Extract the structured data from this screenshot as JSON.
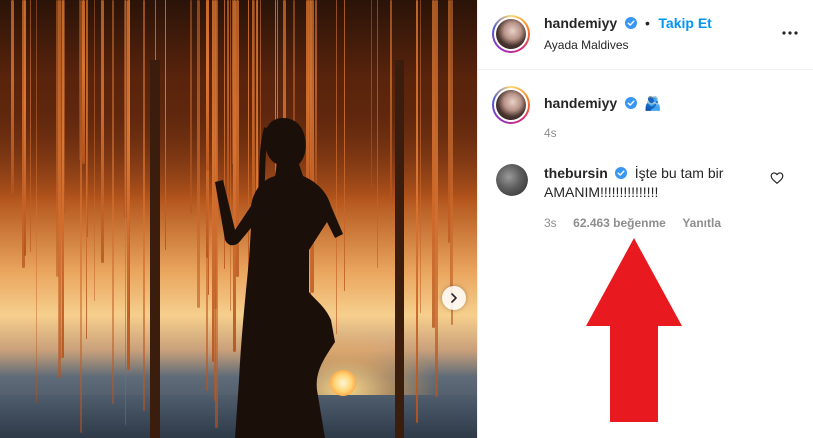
{
  "post": {
    "author": {
      "username": "handemiyy",
      "verified": true,
      "follow_label": "Takip Et",
      "location": "Ayada Maldives"
    },
    "caption": {
      "username": "handemiyy",
      "verified": true,
      "emoji": "🫂",
      "time": "4s"
    },
    "comments": [
      {
        "username": "thebursin",
        "verified": true,
        "text_line1": "İşte bu tam bir",
        "text_line2": "AMANIM!!!!!!!!!!!!!!!",
        "time": "3s",
        "likes": "62.463 beğenme",
        "reply_label": "Yanıtla"
      }
    ]
  },
  "colors": {
    "follow_blue": "#0095f6",
    "verified_blue": "#3897f0",
    "arrow_red": "#e8191f",
    "muted_text": "#8e8e8e"
  },
  "icons": [
    "verified-badge-icon",
    "more-options-icon",
    "heart-outline-icon",
    "chevron-right-icon",
    "red-arrow-up"
  ]
}
